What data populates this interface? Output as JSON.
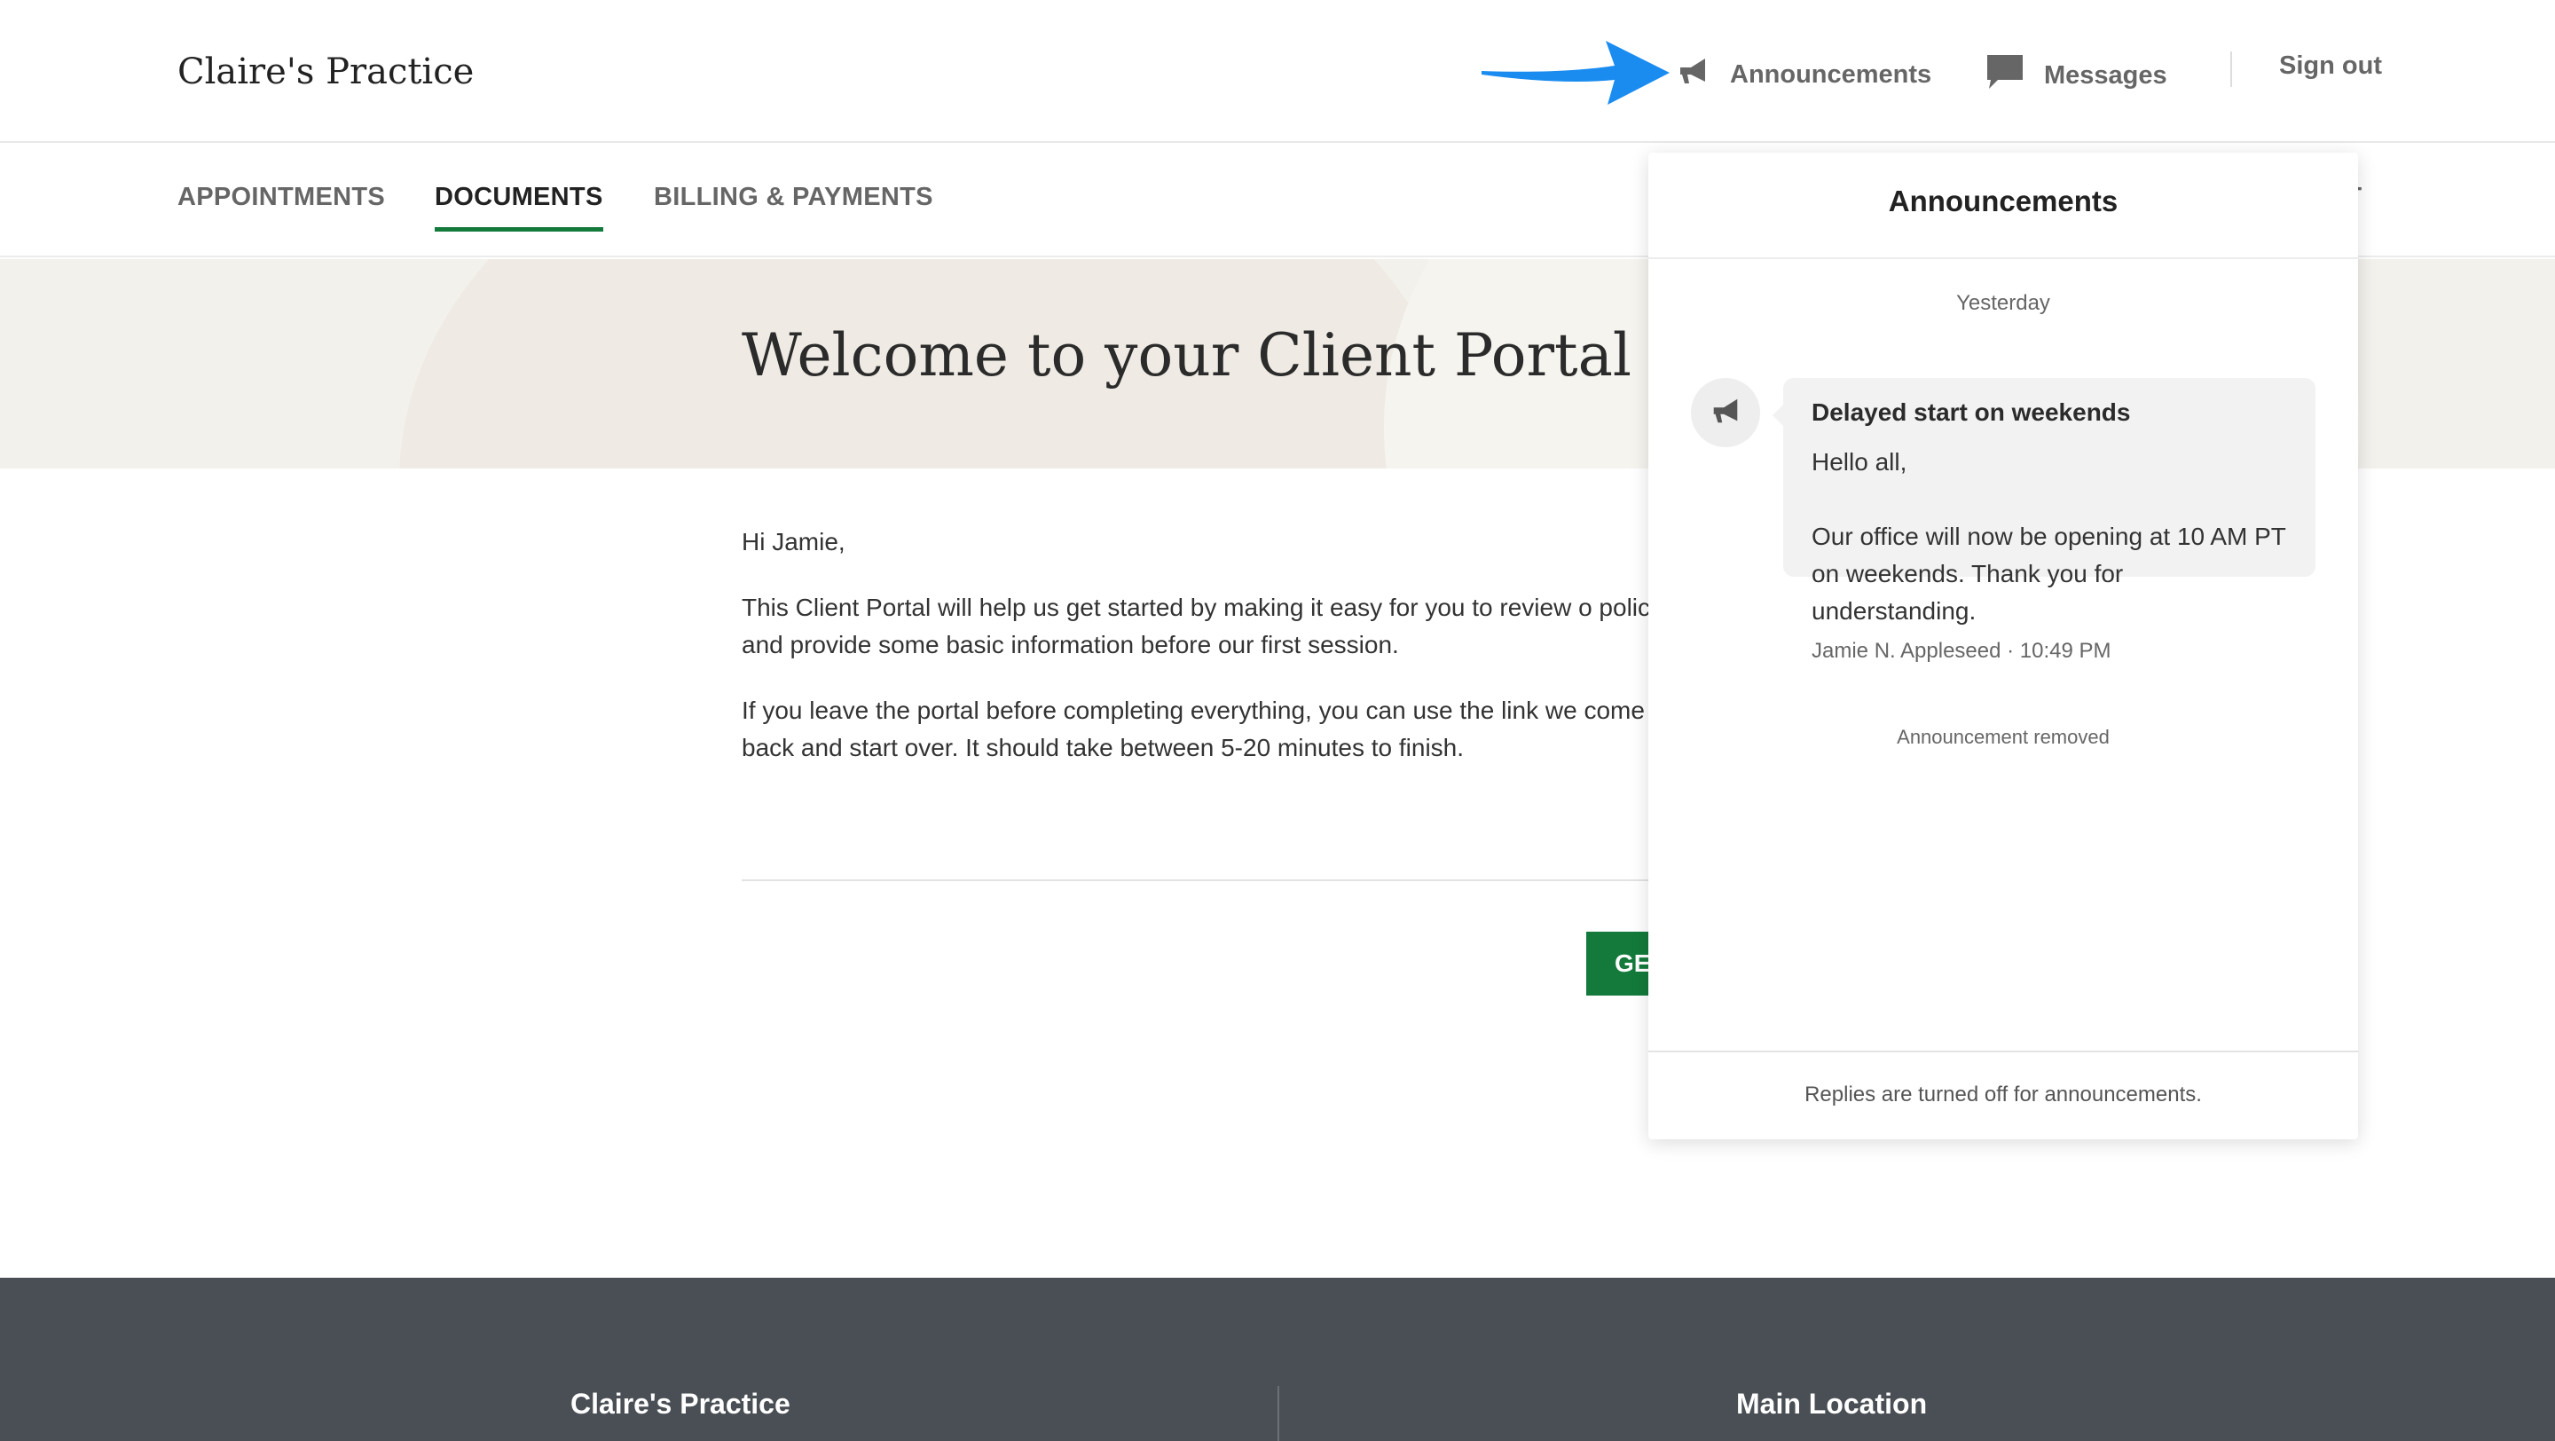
{
  "header": {
    "brand": "Claire's Practice",
    "nav": {
      "announcements_label": "Announcements",
      "messages_label": "Messages",
      "signout_label": "Sign out"
    }
  },
  "subnav": {
    "tabs": [
      {
        "label": "APPOINTMENTS"
      },
      {
        "label": "DOCUMENTS",
        "active": true
      },
      {
        "label": "BILLING & PAYMENTS"
      },
      {
        "label": "IT"
      }
    ]
  },
  "main": {
    "title": "Welcome to your Client Portal",
    "greeting": "Hi Jamie,",
    "paragraph1": "This Client Portal will help us get started by making it easy for you to review o policies and provide some basic information before our first session.",
    "paragraph2": "If you leave the portal before completing everything, you can use the link we come back and start over. It should take between 5-20 minutes to finish.",
    "cta_label": "GE"
  },
  "footer": {
    "col1": "Claire's Practice",
    "col2": "Main Location"
  },
  "announcements_panel": {
    "title": "Announcements",
    "date_label": "Yesterday",
    "item": {
      "title": "Delayed start on weekends",
      "body": "Hello all,\n\nOur office will now be opening at 10 AM PT on weekends. Thank you for understanding.",
      "meta": "Jamie N. Appleseed · 10:49 PM"
    },
    "removed_label": "Announcement removed",
    "footer_note": "Replies are turned off for announcements."
  },
  "colors": {
    "accent_green": "#137a3b",
    "arrow_blue": "#1a8cf0",
    "footer_bg": "#4a4f55"
  },
  "icons": {
    "announcements": "megaphone-icon",
    "messages": "chat-bubble-icon",
    "arrow": "pointer-arrow-icon"
  }
}
